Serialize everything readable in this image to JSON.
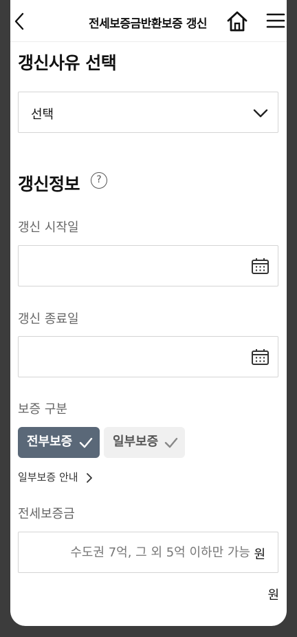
{
  "header": {
    "title": "전세보증금반환보증 갱신"
  },
  "reason": {
    "title": "갱신사유 선택",
    "selected": "선택"
  },
  "renewal_info": {
    "title": "갱신정보",
    "help_symbol": "?",
    "start_label": "갱신 시작일",
    "end_label": "갱신 종료일"
  },
  "guarantee_type": {
    "label": "보증 구분",
    "options": [
      {
        "label": "전부보증",
        "selected": true
      },
      {
        "label": "일부보증",
        "selected": false
      }
    ],
    "guide_link": "일부보증 안내"
  },
  "deposit": {
    "label": "전세보증금",
    "placeholder": "수도권 7억, 그 외 5억 이하만 가능",
    "unit": "원",
    "amount_hangul_unit": "원"
  },
  "colors": {
    "selected_toggle": "#5a6878",
    "unselected_toggle": "#f0f0f0",
    "border": "#d4d4d4"
  }
}
